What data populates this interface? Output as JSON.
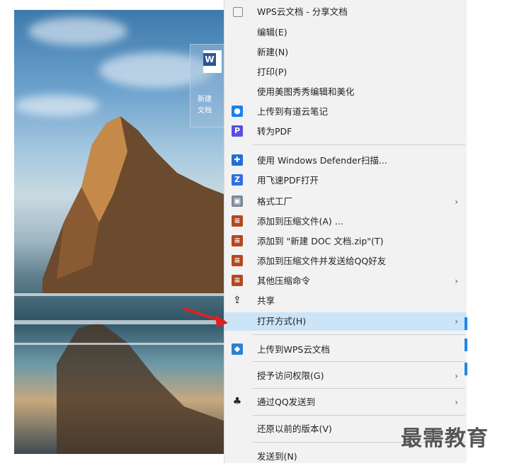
{
  "desktop": {
    "icon_label_line1": "新建",
    "icon_label_line2": "文档"
  },
  "menu": {
    "items": [
      {
        "label": "WPS云文档 - 分享文档",
        "icon": "share-icon",
        "has_submenu": false
      },
      {
        "label": "编辑(E)",
        "icon": "",
        "has_submenu": false
      },
      {
        "label": "新建(N)",
        "icon": "",
        "has_submenu": false
      },
      {
        "label": "打印(P)",
        "icon": "",
        "has_submenu": false
      },
      {
        "label": "使用美图秀秀编辑和美化",
        "icon": "",
        "has_submenu": false
      },
      {
        "label": "上传到有道云笔记",
        "icon": "youdao-icon",
        "has_submenu": false
      },
      {
        "label": "转为PDF",
        "icon": "pdf-icon",
        "has_submenu": false
      },
      {
        "label": "使用 Windows Defender扫描...",
        "icon": "defender-shield-icon",
        "has_submenu": false
      },
      {
        "label": "用飞速PDF打开",
        "icon": "fast-pdf-icon",
        "has_submenu": false
      },
      {
        "label": "格式工厂",
        "icon": "format-factory-icon",
        "has_submenu": true
      },
      {
        "label": "添加到压缩文件(A) ...",
        "icon": "archive-icon",
        "has_submenu": false
      },
      {
        "label": "添加到 \"新建 DOC 文档.zip\"(T)",
        "icon": "archive-icon",
        "has_submenu": false
      },
      {
        "label": "添加到压缩文件并发送给QQ好友",
        "icon": "archive-icon",
        "has_submenu": false
      },
      {
        "label": "其他压缩命令",
        "icon": "archive-icon",
        "has_submenu": true
      },
      {
        "label": "共享",
        "icon": "share-arrow-icon",
        "has_submenu": false
      },
      {
        "label": "打开方式(H)",
        "icon": "",
        "has_submenu": true
      },
      {
        "label": "上传到WPS云文档",
        "icon": "wps-cloud-icon",
        "has_submenu": false
      },
      {
        "label": "授予访问权限(G)",
        "icon": "",
        "has_submenu": true
      },
      {
        "label": "通过QQ发送到",
        "icon": "qq-penguin-icon",
        "has_submenu": true
      },
      {
        "label": "还原以前的版本(V)",
        "icon": "",
        "has_submenu": false
      },
      {
        "label": "发送到(N)",
        "icon": "",
        "has_submenu": true
      }
    ],
    "submenu_arrow": "›"
  },
  "watermark": "最需教育",
  "colors": {
    "menu_bg": "#f2f2f2",
    "highlight": "#cce4f7",
    "pointer": "#e02020"
  }
}
